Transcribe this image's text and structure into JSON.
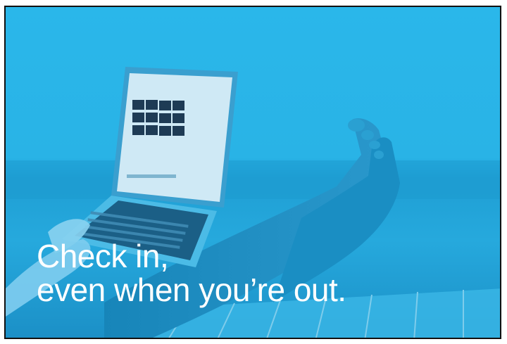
{
  "headline": {
    "line1": "Check in,",
    "line2": "even when you’re out."
  },
  "colors": {
    "background": "#29b8ea",
    "overlay": "#1c9fd8",
    "text": "#ffffff",
    "border": "#111111"
  }
}
